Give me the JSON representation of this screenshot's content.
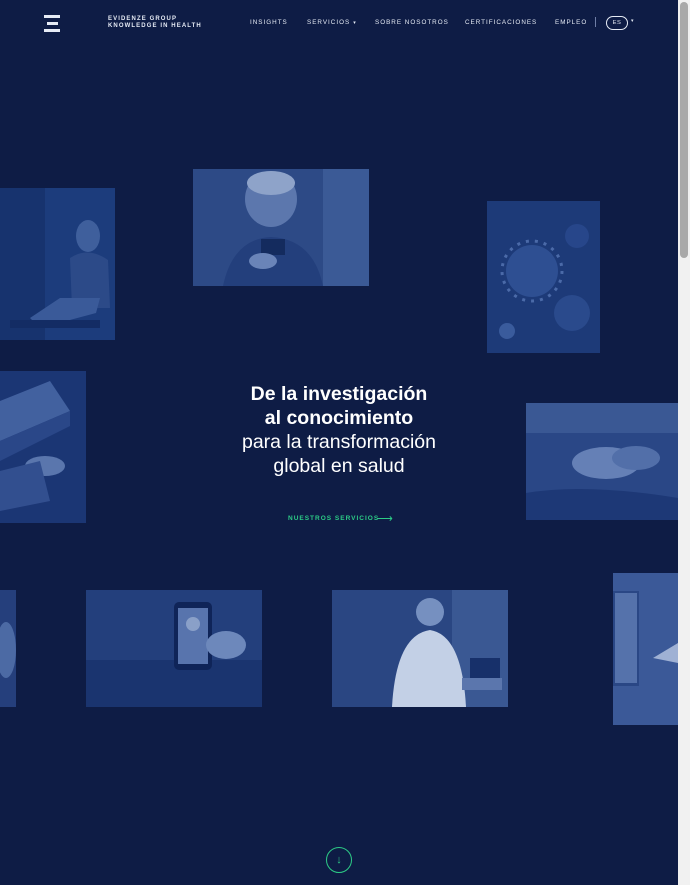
{
  "header": {
    "brand_line1": "EVIDENZE GROUP",
    "brand_line2": "KNOWLEDGE IN HEALTH",
    "nav": {
      "insights": "INSIGHTS",
      "servicios": "SERVICIOS",
      "sobre": "SOBRE NOSOTROS",
      "certificaciones": "CERTIFICACIONES",
      "empleo": "EMPLEO"
    },
    "language": "ES"
  },
  "hero": {
    "line1": "De la investigación",
    "line2": "al conocimiento",
    "line3": "para la transformación",
    "line4": "global en salud",
    "cta_label": "NUESTROS SERVICIOS"
  },
  "icons": {
    "logo": "evidenze-e-logo",
    "servicios_caret": "chevron-down-icon",
    "language_caret": "chevron-down-icon",
    "cta_arrow": "arrow-right-icon",
    "scroll_down": "arrow-down-icon"
  },
  "colors": {
    "background": "#0e1c45",
    "accent_green": "#2ccb86",
    "photo_tint": "#2a4a8a"
  }
}
